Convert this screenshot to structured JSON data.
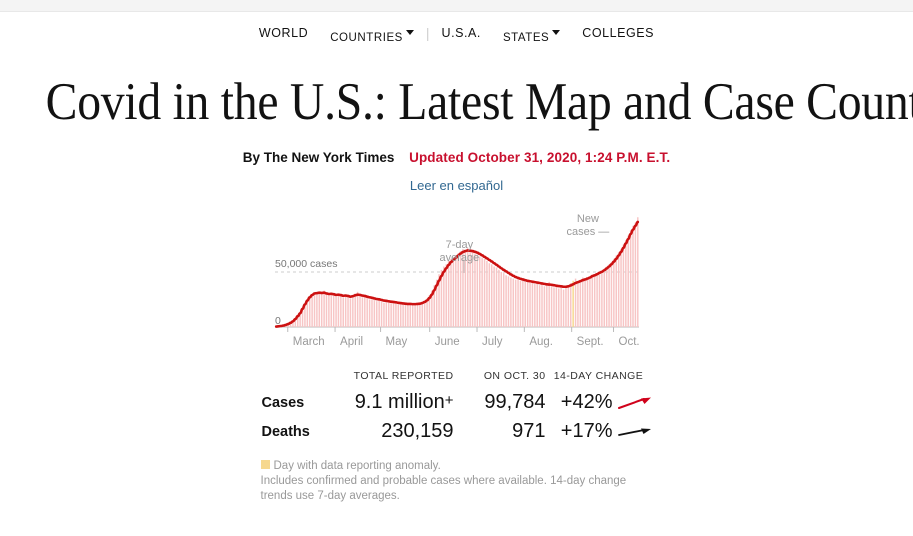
{
  "nav": {
    "items": [
      {
        "label": "WORLD",
        "caret": false,
        "size": "normal"
      },
      {
        "label": "COUNTRIES",
        "caret": true,
        "size": "small"
      },
      {
        "label": "U.S.A.",
        "caret": false,
        "size": "normal"
      },
      {
        "label": "STATES",
        "caret": true,
        "size": "small"
      },
      {
        "label": "COLLEGES",
        "caret": false,
        "size": "normal"
      }
    ]
  },
  "headline": "Covid in the U.S.: Latest Map and Case Count",
  "byline": {
    "author": "By The New York Times",
    "updated": "Updated October 31, 2020, 1:24 P.M. E.T.",
    "translation_link": "Leer en español"
  },
  "annotations": {
    "seven_day": "7-day\naverage",
    "seven_day_l1": "7-day",
    "seven_day_l2": "average",
    "new_cases_l1": "New",
    "new_cases_l2": "cases —"
  },
  "colors": {
    "accent_red": "#d0021b",
    "line_red": "#cc1111",
    "bar_pink": "#f7c5c5",
    "anomaly_yellow": "#f6d88f",
    "link_blue": "#326891",
    "axis_gray": "#9a9a9a"
  },
  "stats": {
    "headers": [
      "",
      "TOTAL REPORTED",
      "ON OCT. 30",
      "14-DAY CHANGE"
    ],
    "rows": [
      {
        "label": "Cases",
        "total": "9.1 million",
        "total_sup": "+",
        "daily": "99,784",
        "change": "+42%",
        "arrow": "up-red",
        "highlight": true
      },
      {
        "label": "Deaths",
        "total": "230,159",
        "total_sup": "",
        "daily": "971",
        "change": "+17%",
        "arrow": "flat-black",
        "highlight": false
      }
    ]
  },
  "notes": {
    "anomaly": "Day with data reporting anomaly.",
    "body": "Includes confirmed and probable cases where available. 14-day change trends use 7-day averages."
  },
  "chart_data": {
    "type": "bar",
    "title": "",
    "xlabel": "",
    "ylabel": "cases",
    "ylim": [
      0,
      100000
    ],
    "gridlines": [
      {
        "value": 50000,
        "label": "50,000 cases",
        "style": "dashed"
      },
      {
        "value": 0,
        "label": "0",
        "style": "solid"
      }
    ],
    "categories": [
      "March",
      "April",
      "May",
      "June",
      "July",
      "Aug.",
      "Sept.",
      "Oct."
    ],
    "tick_positions_frac": [
      0.035,
      0.165,
      0.29,
      0.425,
      0.555,
      0.685,
      0.815,
      0.93
    ],
    "series": [
      {
        "name": "New cases (daily)",
        "type": "bar",
        "color": "#f7c5c5",
        "values": [
          300,
          500,
          800,
          1200,
          1800,
          2500,
          3500,
          5000,
          7000,
          9500,
          12000,
          16000,
          20000,
          24000,
          27000,
          29000,
          31000,
          30000,
          32000,
          31000,
          33000,
          30500,
          29000,
          31000,
          29500,
          28000,
          30000,
          28500,
          27000,
          29000,
          27500,
          26000,
          28500,
          30500,
          32000,
          29000,
          27000,
          28000,
          26500,
          25000,
          26000,
          24500,
          23500,
          25000,
          23000,
          22000,
          24000,
          22500,
          21500,
          23000,
          21000,
          20500,
          22000,
          20000,
          21000,
          20500,
          21500,
          20000,
          21000,
          22000,
          21500,
          22500,
          24000,
          26000,
          29000,
          33000,
          38000,
          43000,
          48000,
          52000,
          55000,
          57000,
          60000,
          62000,
          63000,
          65000,
          67000,
          69000,
          71000,
          70000,
          72000,
          68000,
          70000,
          67000,
          66000,
          64000,
          63000,
          62000,
          60000,
          58000,
          57000,
          55000,
          54000,
          52000,
          50000,
          49000,
          47000,
          46000,
          45000,
          44000,
          43000,
          45000,
          42000,
          44000,
          41000,
          43000,
          40000,
          42000,
          39000,
          41000,
          38000,
          40000,
          37000,
          39000,
          41000,
          38000,
          36000,
          38000,
          35000,
          37000,
          34000,
          36000,
          38000,
          40000,
          42000,
          44000,
          41000,
          43000,
          45000,
          42000,
          44000,
          46000,
          48000,
          47000,
          49000,
          51000,
          50000,
          53000,
          55000,
          57000,
          59000,
          62000,
          65000,
          68000,
          71000,
          75000,
          79000,
          83000,
          88000,
          92000,
          95000,
          99784
        ]
      },
      {
        "name": "7-day average",
        "type": "line",
        "color": "#cc1111",
        "values": [
          400,
          600,
          900,
          1300,
          1900,
          2700,
          3800,
          5200,
          7200,
          9800,
          12500,
          16500,
          20500,
          24000,
          27000,
          29000,
          30500,
          30800,
          31200,
          31000,
          31200,
          30500,
          30000,
          30200,
          29800,
          29200,
          29400,
          29000,
          28400,
          28600,
          28200,
          27600,
          28000,
          28800,
          29400,
          29200,
          28600,
          28200,
          27600,
          27000,
          26600,
          26000,
          25400,
          25200,
          24600,
          24000,
          23800,
          23400,
          23000,
          22800,
          22400,
          22000,
          21800,
          21400,
          21200,
          21000,
          21000,
          20800,
          20800,
          21000,
          21200,
          21800,
          22800,
          24200,
          26400,
          29400,
          33400,
          37800,
          42200,
          46400,
          50200,
          53400,
          56400,
          59000,
          61000,
          63000,
          65000,
          66800,
          68200,
          69000,
          69600,
          69400,
          69000,
          68400,
          67600,
          66400,
          65200,
          63800,
          62400,
          61000,
          59600,
          58000,
          56600,
          55000,
          53400,
          52000,
          50600,
          49200,
          47800,
          46600,
          45400,
          44600,
          43800,
          43200,
          42600,
          42000,
          41600,
          41200,
          40800,
          40400,
          40000,
          39600,
          39200,
          38800,
          38600,
          38400,
          38000,
          37600,
          37200,
          37000,
          36600,
          36600,
          37000,
          37800,
          38800,
          40000,
          40800,
          41600,
          42600,
          43200,
          44000,
          45000,
          46200,
          47000,
          48000,
          49200,
          50200,
          51600,
          53200,
          55000,
          57000,
          59400,
          62000,
          65000,
          68200,
          72000,
          76000,
          80000,
          84500,
          88500,
          92000,
          95500
        ]
      }
    ],
    "anomalies": [
      {
        "index": 124,
        "color": "#f6d88f",
        "note": "Day with data reporting anomaly."
      }
    ],
    "annotations": [
      {
        "text": "7-day average",
        "target": "line",
        "position": "above-july-peak"
      },
      {
        "text": "New cases",
        "target": "bars",
        "position": "top-right"
      }
    ],
    "legend": "none",
    "grid": true
  }
}
